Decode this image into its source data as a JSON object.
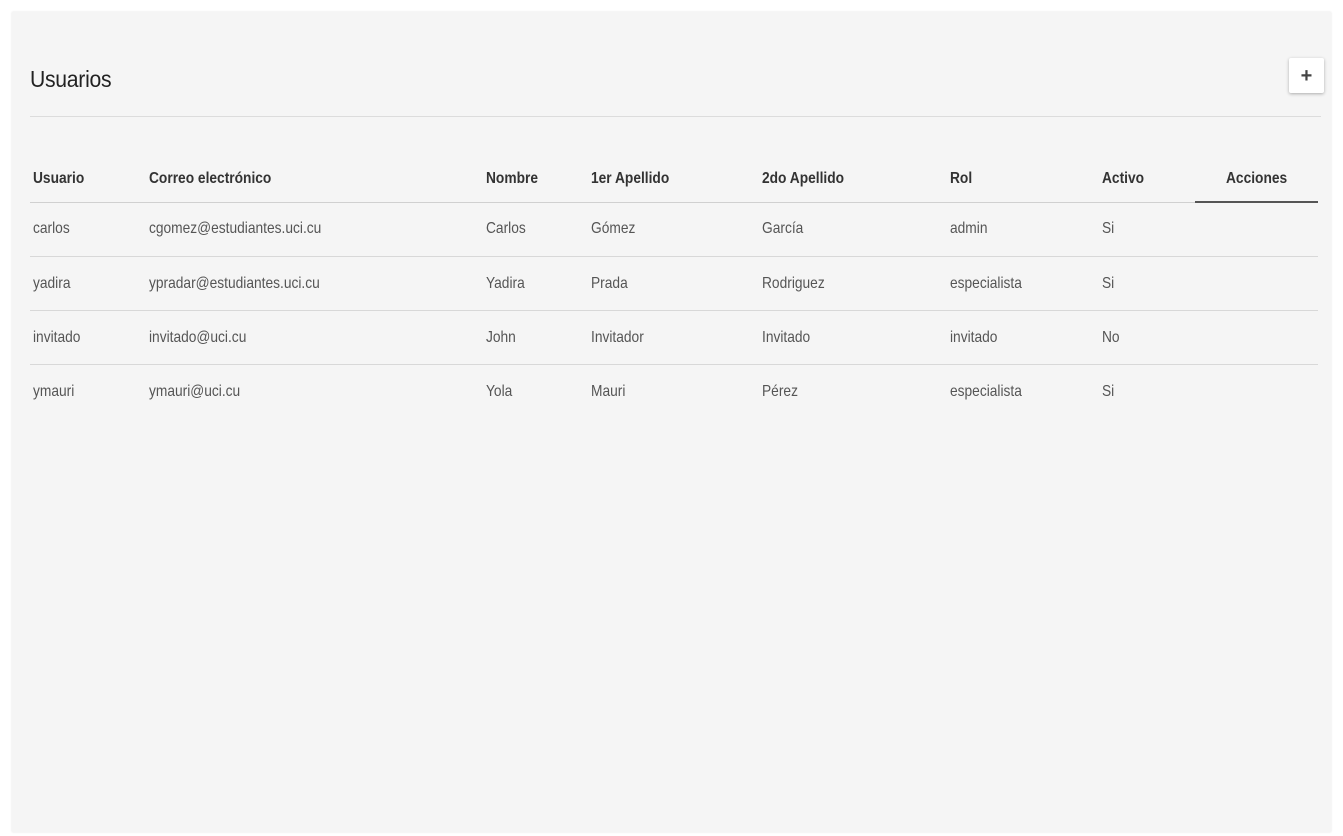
{
  "page": {
    "title": "Usuarios",
    "add_button_label": "+"
  },
  "table": {
    "headers": {
      "usuario": "Usuario",
      "correo": "Correo electrónico",
      "nombre": "Nombre",
      "apellido1": "1er Apellido",
      "apellido2": "2do Apellido",
      "rol": "Rol",
      "activo": "Activo",
      "acciones": "Acciones"
    },
    "rows": [
      {
        "usuario": "carlos",
        "correo": "cgomez@estudiantes.uci.cu",
        "nombre": "Carlos",
        "apellido1": "Gómez",
        "apellido2": "García",
        "rol": "admin",
        "activo": "Si"
      },
      {
        "usuario": "yadira",
        "correo": "ypradar@estudiantes.uci.cu",
        "nombre": "Yadira",
        "apellido1": "Prada",
        "apellido2": "Rodriguez",
        "rol": "especialista",
        "activo": "Si"
      },
      {
        "usuario": "invitado",
        "correo": "invitado@uci.cu",
        "nombre": "John",
        "apellido1": "Invitador",
        "apellido2": "Invitado",
        "rol": "invitado",
        "activo": "No"
      },
      {
        "usuario": "ymauri",
        "correo": "ymauri@uci.cu",
        "nombre": "Yola",
        "apellido1": "Mauri",
        "apellido2": "Pérez",
        "rol": "especialista",
        "activo": "Si"
      }
    ]
  },
  "colors": {
    "panel_background": "#f5f5f5",
    "header_text": "#333333",
    "cell_text": "#555555",
    "divider": "#d8d8d8"
  },
  "icons": {
    "add": "plus-icon"
  }
}
